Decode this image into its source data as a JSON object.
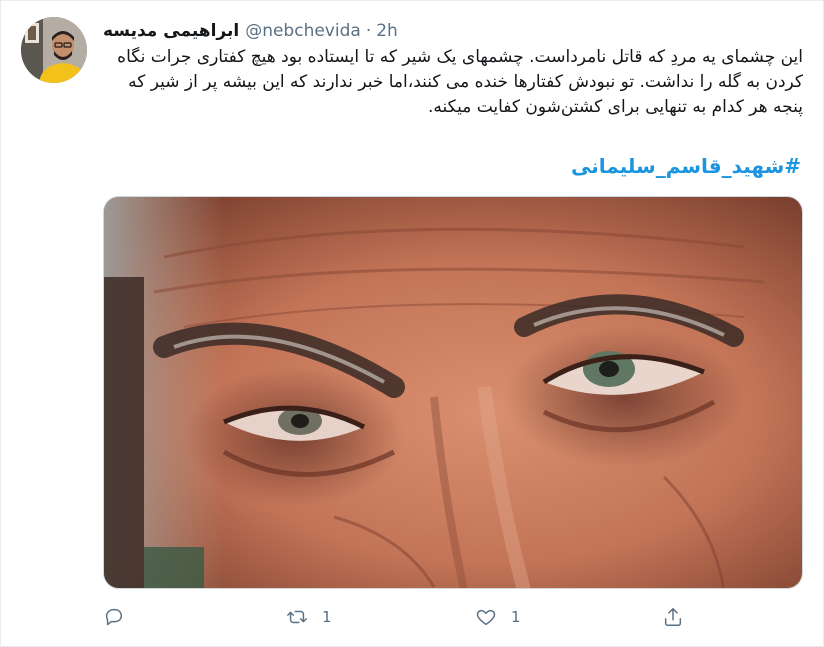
{
  "tweet": {
    "display_name": "ابراهیمی مدیسه",
    "handle": "@nebchevida",
    "separator": "·",
    "time": "2h",
    "text": "این چشمای یه مردِ که قاتل نامرداست. چشمهای یک شیر که تا ایستاده بود هیچ کفتاری جرات نگاه کردن به گله را نداشت. تو نبودش کفتارها خنده می کنند،اما خبر ندارند که این بیشه پر از شیر که پنجه هر کدام به تنهایی برای کشتن‌شون کفایت میکنه.",
    "hashtag": "#شهید_قاسم_سلیمانی"
  },
  "actions": {
    "reply": {
      "icon": "reply-icon"
    },
    "retweet": {
      "icon": "retweet-icon",
      "count": "1"
    },
    "like": {
      "icon": "heart-icon",
      "count": "1"
    },
    "share": {
      "icon": "share-icon"
    }
  },
  "colors": {
    "link": "#1b95e0",
    "secondary_text": "#5b7083",
    "primary_text": "#14171a",
    "border": "#e6ecf0"
  }
}
